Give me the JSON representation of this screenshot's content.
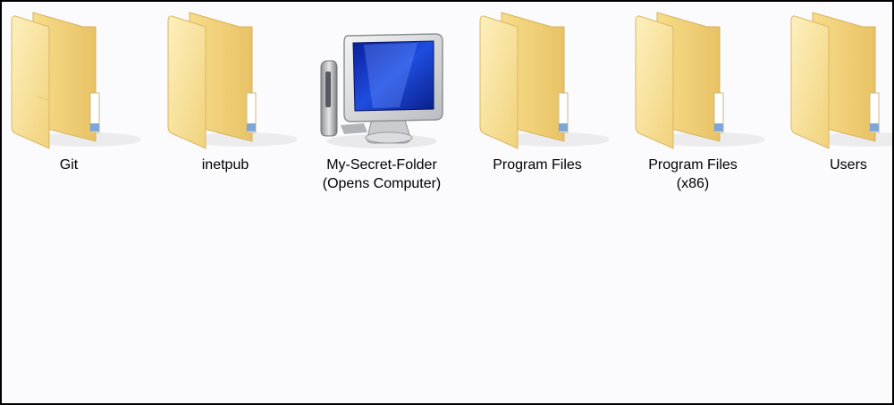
{
  "items": [
    {
      "label": "Git",
      "label2": "",
      "icon": "folder-icon"
    },
    {
      "label": "inetpub",
      "label2": "",
      "icon": "folder-icon"
    },
    {
      "label": "My-Secret-Folder",
      "label2": "(Opens Computer)",
      "icon": "computer-icon"
    },
    {
      "label": "Program Files",
      "label2": "",
      "icon": "folder-icon"
    },
    {
      "label": "Program Files",
      "label2": "(x86)",
      "icon": "folder-icon"
    },
    {
      "label": "Users",
      "label2": "",
      "icon": "folder-icon"
    }
  ],
  "colors": {
    "folder_light": "#fbe9a6",
    "folder_mid": "#f3d37a",
    "folder_dark": "#e0b758",
    "screen_blue": "#1a3fd0",
    "frame": "#000000"
  }
}
